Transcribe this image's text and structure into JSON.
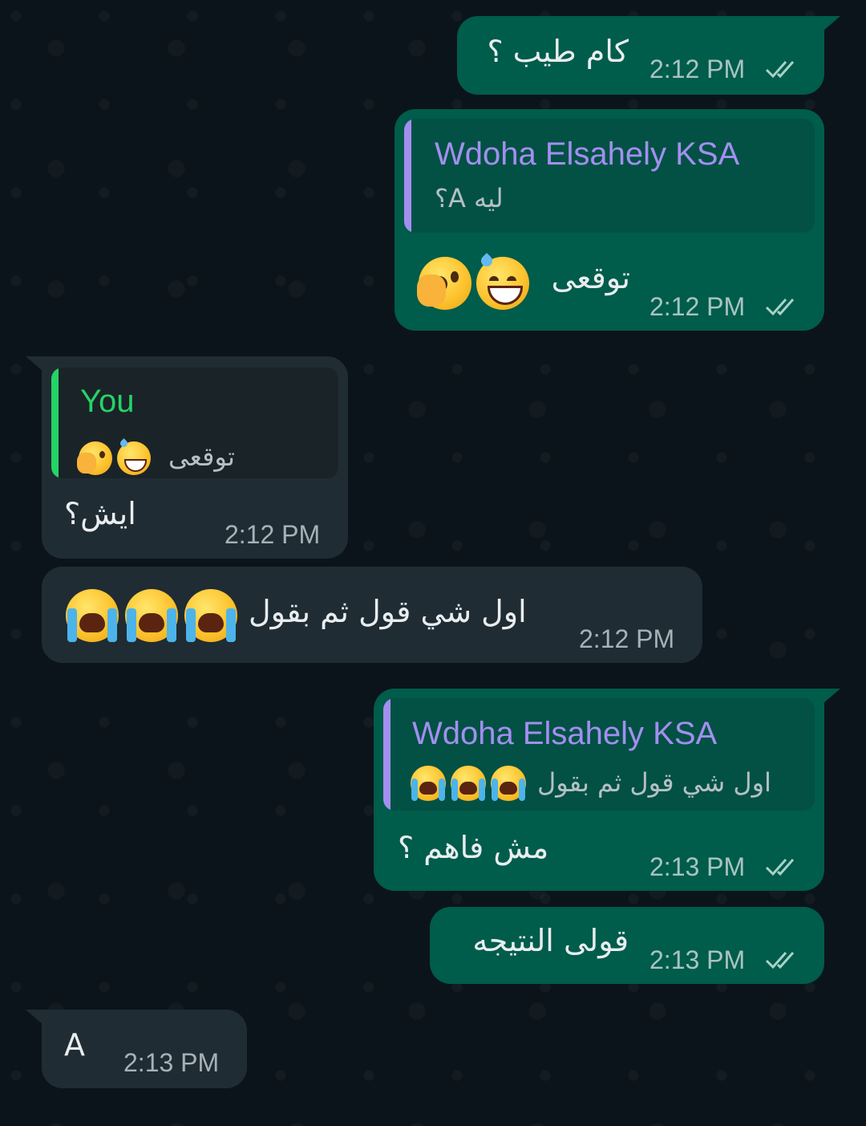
{
  "colors": {
    "outgoing_bubble": "#005c4b",
    "incoming_bubble": "#202c33",
    "background": "#0b141a",
    "quote_name_other": "#a28ff0",
    "quote_name_you": "#25d366",
    "read_ticks": "#a8d3c8"
  },
  "messages": [
    {
      "direction": "out",
      "text": "كام طيب ؟",
      "time": "2:12 PM",
      "status": "read"
    },
    {
      "direction": "out",
      "reply_to": {
        "name": "Wdoha Elsahely KSA",
        "text": "ليه A؟"
      },
      "text": "توقعى",
      "emojis": [
        "sweat-smile-emoji",
        "face-hand-over-mouth-emoji"
      ],
      "time": "2:12 PM",
      "status": "read"
    },
    {
      "direction": "in",
      "reply_to": {
        "name": "You",
        "text": "توقعى",
        "emojis": [
          "sweat-smile-emoji",
          "face-hand-over-mouth-emoji"
        ]
      },
      "text": "ايش؟",
      "time": "2:12 PM"
    },
    {
      "direction": "in",
      "text": "اول شي قول ثم بقول",
      "emojis": [
        "loudly-crying-emoji",
        "loudly-crying-emoji",
        "loudly-crying-emoji"
      ],
      "time": "2:12 PM"
    },
    {
      "direction": "out",
      "reply_to": {
        "name": "Wdoha Elsahely KSA",
        "text": "اول شي قول ثم بقول",
        "emojis": [
          "loudly-crying-emoji",
          "loudly-crying-emoji",
          "loudly-crying-emoji"
        ]
      },
      "text": "مش فاهم ؟",
      "time": "2:13 PM",
      "status": "read"
    },
    {
      "direction": "out",
      "text": "قولى النتيجه",
      "time": "2:13 PM",
      "status": "read"
    },
    {
      "direction": "in",
      "text": "A",
      "time": "2:13 PM"
    }
  ]
}
